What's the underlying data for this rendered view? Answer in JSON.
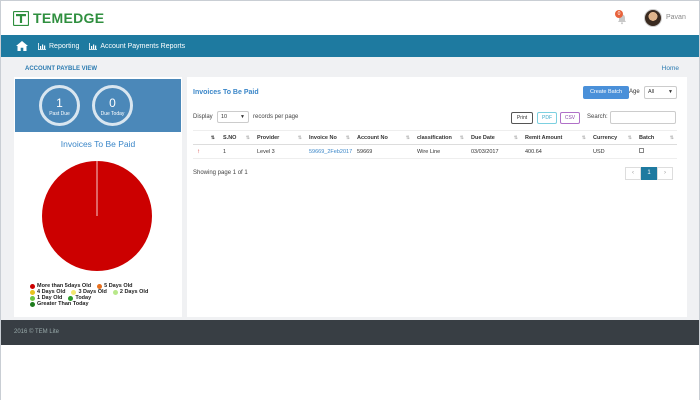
{
  "brand": {
    "name": "TEMEDGE"
  },
  "header": {
    "notification_count": "0",
    "user_name": "Pavan"
  },
  "nav": {
    "items": [
      {
        "label": "Reporting"
      },
      {
        "label": "Account Payments Reports"
      }
    ]
  },
  "breadcrumb": {
    "title": "ACCOUNT PAYBLE VIEW",
    "home": "Home"
  },
  "stats": [
    {
      "value": "1",
      "label": "Past Due"
    },
    {
      "value": "0",
      "label": "Due Today"
    }
  ],
  "left_panel": {
    "title": "Invoices To Be Paid"
  },
  "chart_data": {
    "type": "pie",
    "slices": [
      {
        "label": "More than 5days Old",
        "value": 1,
        "color": "#cc0000"
      },
      {
        "label": "5 Days Old",
        "value": 0,
        "color": "#e8701e"
      },
      {
        "label": "4 Days Old",
        "value": 0,
        "color": "#e8c41e"
      },
      {
        "label": "3 Days Old",
        "value": 0,
        "color": "#f2e870"
      },
      {
        "label": "2 Days Old",
        "value": 0,
        "color": "#b8e88a"
      },
      {
        "label": "1 Day Old",
        "value": 0,
        "color": "#6cc644"
      },
      {
        "label": "Today",
        "value": 0,
        "color": "#2a9a2a"
      },
      {
        "label": "Greater Than Today",
        "value": 0,
        "color": "#1c7a1c"
      }
    ]
  },
  "main": {
    "title": "Invoices To Be Paid",
    "create_batch": "Create Batch",
    "age_label": "Age",
    "age_value": "All",
    "display_label": "Display",
    "page_length": "10",
    "rpp_label": "records per page",
    "export": {
      "print": "Print",
      "pdf": "PDF",
      "csv": "CSV"
    },
    "search_label": "Search:",
    "columns": [
      "S.NO",
      "Provider",
      "Invoice No",
      "Account No",
      "classification",
      "Due Date",
      "Remit Amount",
      "Currency",
      "Batch"
    ],
    "rows": [
      {
        "sno": "1",
        "provider": "Level 3",
        "invoice": "59669_2Feb2017",
        "account": "59669",
        "classification": "Wire Line",
        "due": "03/03/2017",
        "amount": "400.64",
        "currency": "USD"
      }
    ],
    "showing": "Showing page 1 of 1",
    "pager": {
      "prev": "‹",
      "current": "1",
      "next": "›"
    }
  },
  "footer": {
    "text": "2016 © TEM Lite"
  }
}
